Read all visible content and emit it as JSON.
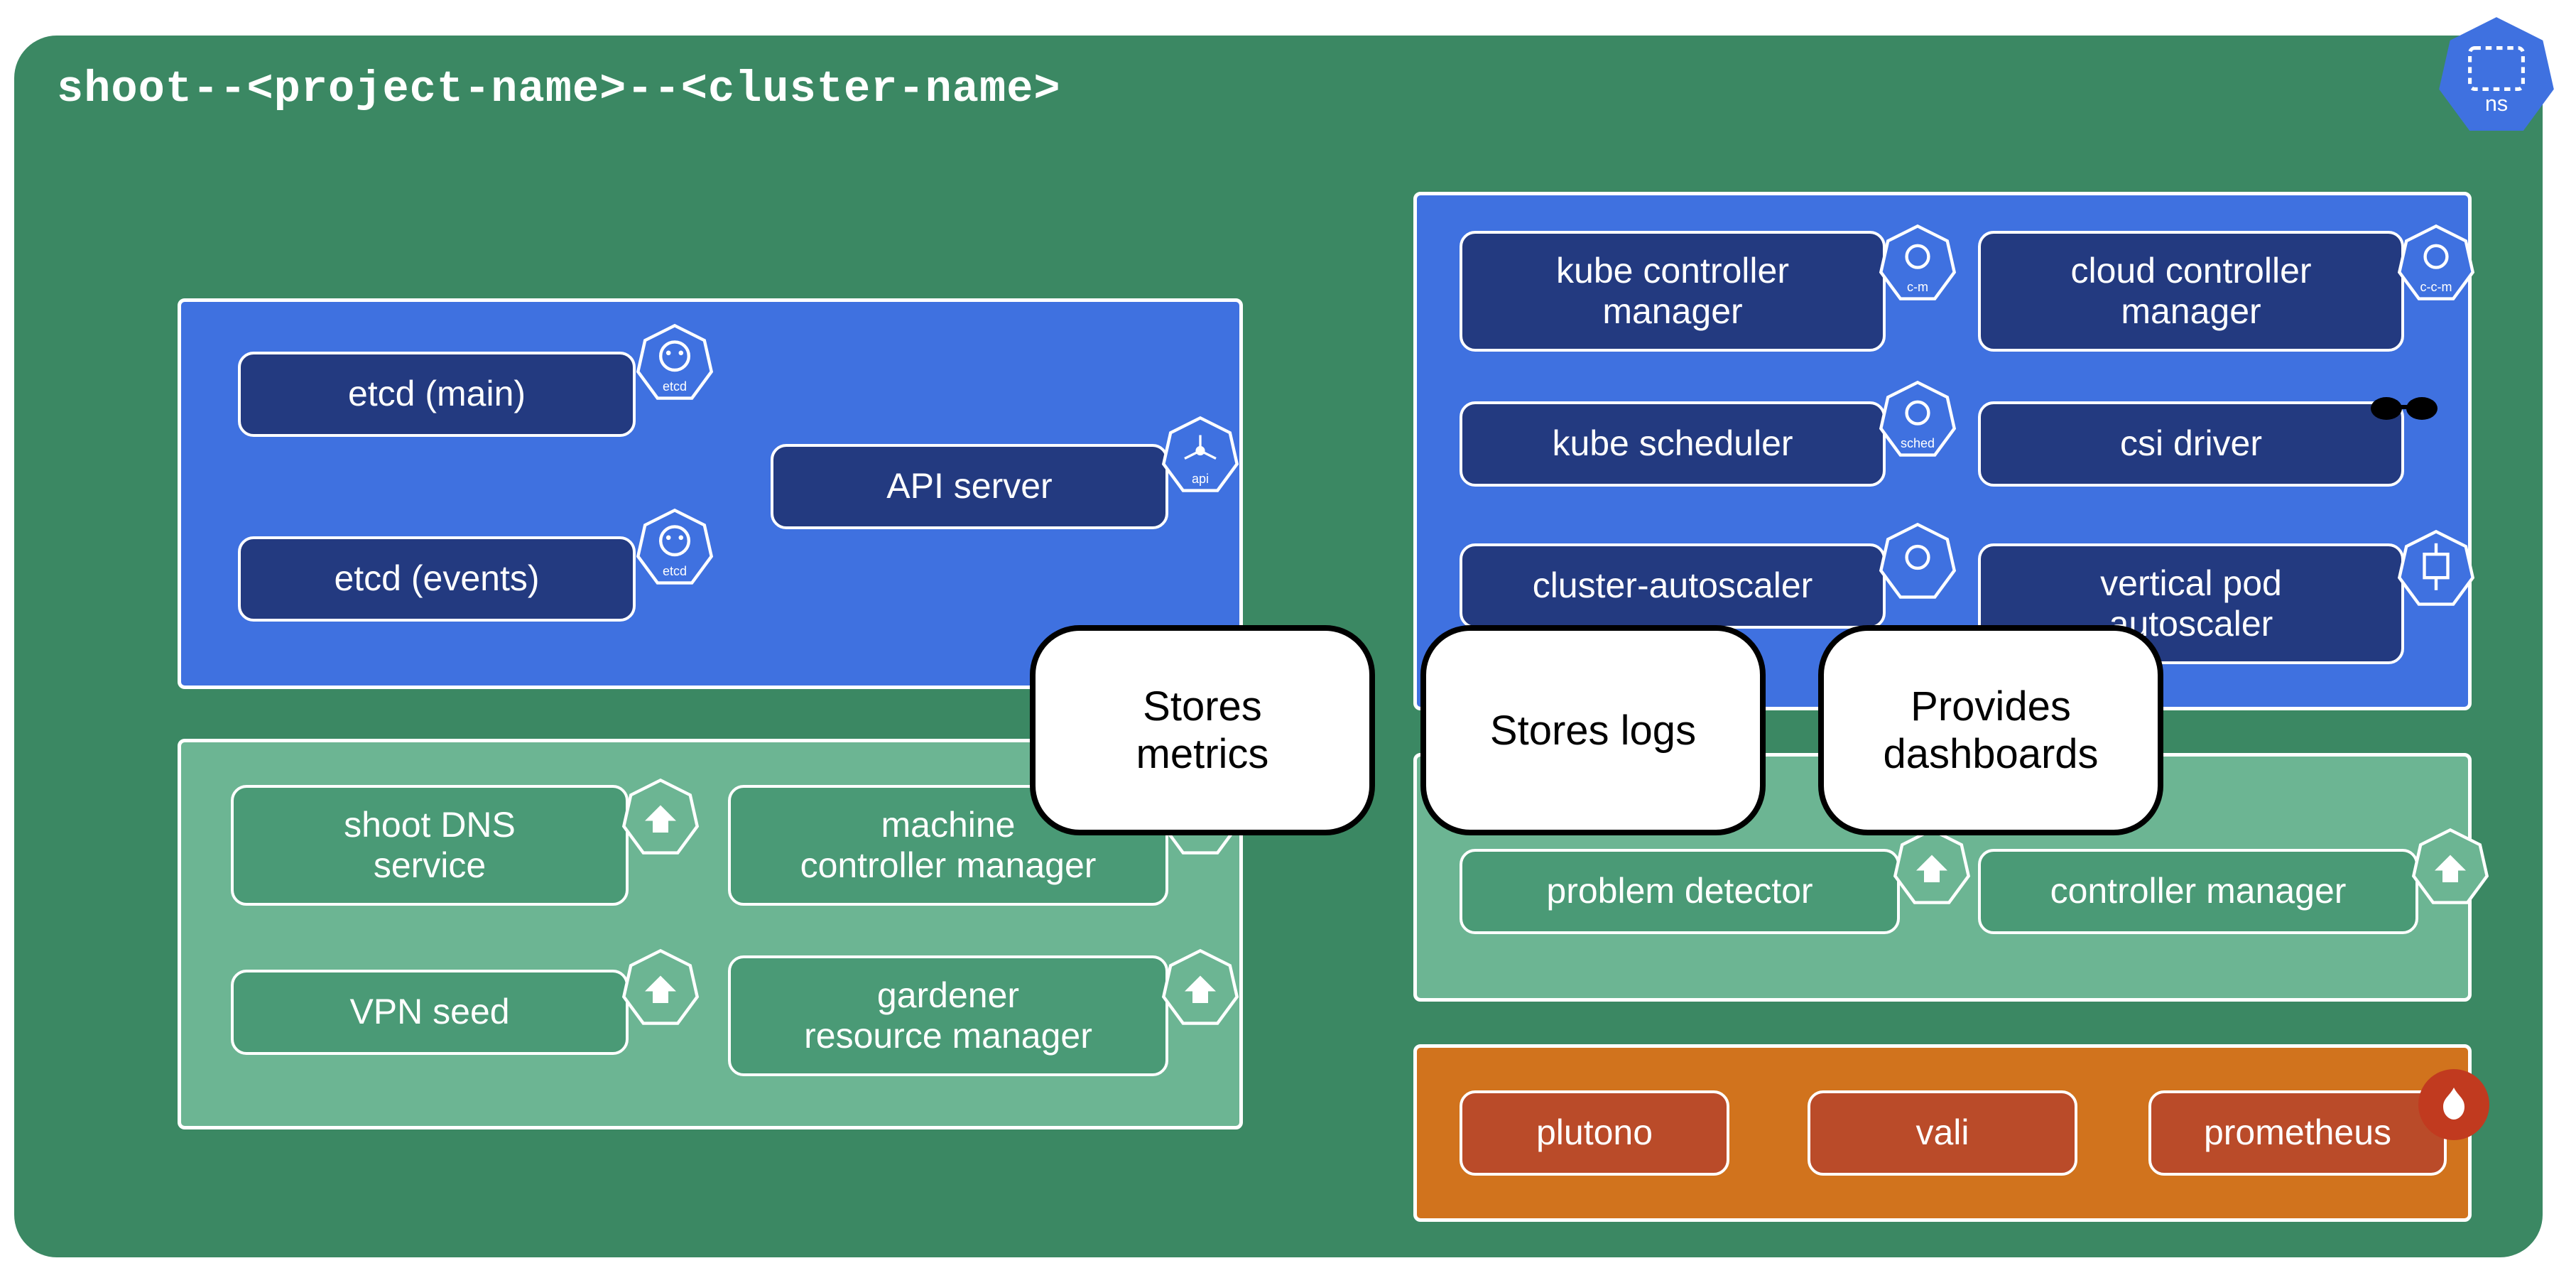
{
  "namespace_title": "shoot--<project-name>--<cluster-name>",
  "ns_badge_label": "ns",
  "panels": {
    "etcd_api": {
      "etcd_main": "etcd (main)",
      "etcd_events": "etcd (events)",
      "api_server": "API server",
      "etcd_badge": "etcd",
      "api_badge": "api"
    },
    "controllers": {
      "kcm": "kube controller\nmanager",
      "ccm": "cloud controller\nmanager",
      "kube_scheduler": "kube scheduler",
      "csi_driver": "csi driver",
      "cluster_autoscaler": "cluster-autoscaler",
      "vpa": "vertical pod\nautoscaler",
      "badge_cm": "c-m",
      "badge_ccm": "c-c-m",
      "badge_sched": "sched"
    },
    "gardener_left": {
      "dns_service": "shoot DNS\nservice",
      "mcm": "machine\ncontroller manager",
      "vpn_seed": "VPN seed",
      "grm": "gardener\nresource manager"
    },
    "gardener_right": {
      "problem_detector": "problem detector",
      "controller_manager": "controller manager"
    },
    "observability": {
      "plutono": "plutono",
      "vali": "vali",
      "prometheus": "prometheus"
    }
  },
  "bubbles": {
    "metrics": "Stores\nmetrics",
    "logs": "Stores logs",
    "dashboards": "Provides\ndashboards"
  },
  "icons": {
    "gardener": "gardener-leaf-icon",
    "gear": "gear-icon",
    "cube": "cube-icon",
    "flame": "prometheus-flame-icon",
    "sunglasses": "sunglasses-icon"
  }
}
